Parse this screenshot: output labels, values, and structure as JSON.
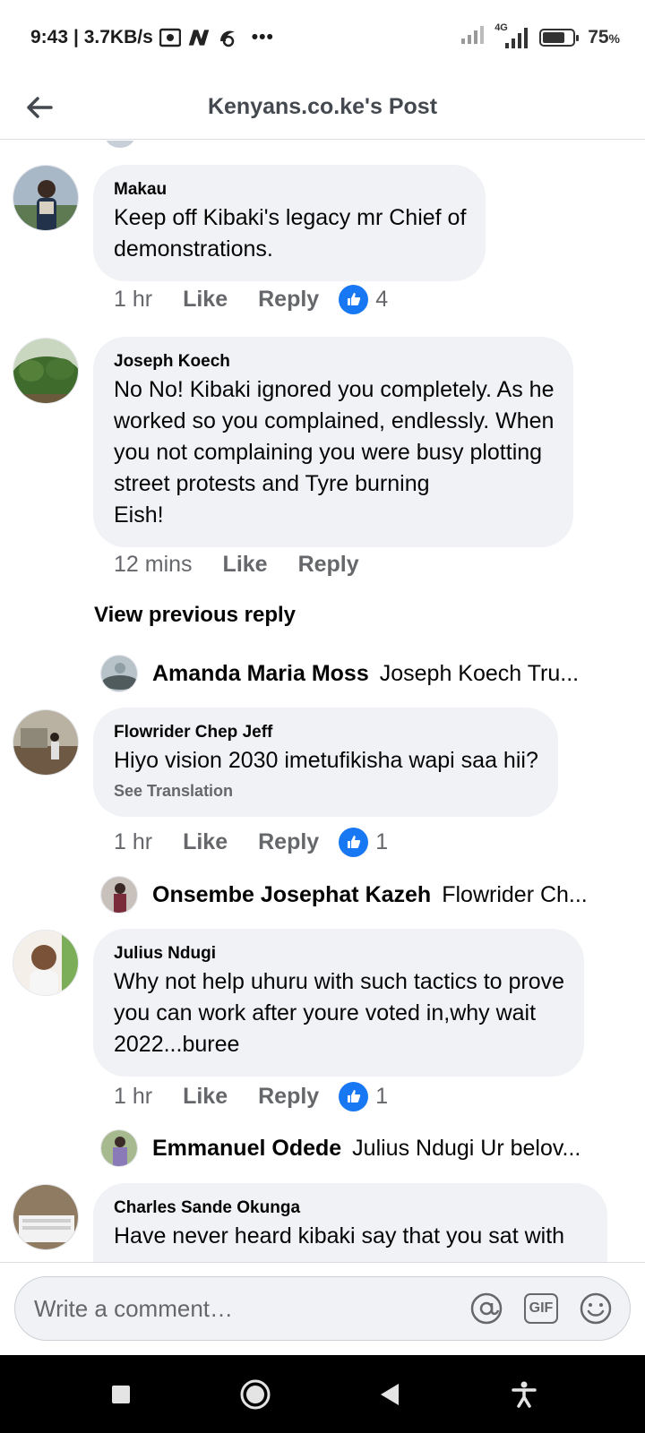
{
  "status_bar": {
    "time": "9:43",
    "net_speed": "| 3.7KB/s",
    "more": "•••",
    "network_type": "4G",
    "battery": "75",
    "battery_unit": "%",
    "battery_level": 0.75
  },
  "header": {
    "title": "Kenyans.co.ke's Post"
  },
  "comments": [
    {
      "author": "Makau",
      "text": "Keep off Kibaki's legacy mr Chief of\ndemonstrations.",
      "time": "1 hr",
      "like_label": "Like",
      "reply_label": "Reply",
      "reactions": "4",
      "avatar_color": "#4a6f8f"
    },
    {
      "author": "Joseph Koech",
      "text": "No No! Kibaki ignored you completely. As he\nworked so you complained, endlessly. When\nyou not complaining you were busy plotting\nstreet protests and Tyre burning\n Eish!",
      "time": "12 mins",
      "like_label": "Like",
      "reply_label": "Reply",
      "avatar_color": "#3e6b2f"
    },
    {
      "author": "Flowrider Chep Jeff",
      "text": "Hiyo vision 2030 imetufikisha wapi saa hii?",
      "translation": "See Translation",
      "time": "1 hr",
      "like_label": "Like",
      "reply_label": "Reply",
      "reactions": "1",
      "avatar_color": "#6b5a44"
    },
    {
      "author": "Julius Ndugi",
      "text": " Why not help uhuru with such tactics to prove\nyou can work after youre voted in,why wait\n2022...buree",
      "time": "1 hr",
      "like_label": "Like",
      "reply_label": "Reply",
      "reactions": "1",
      "avatar_color": "#d9c3a8"
    },
    {
      "author": "Charles Sande Okunga",
      "text": "Have never heard kibaki say that you sat with",
      "avatar_color": "#5b4632"
    }
  ],
  "view_previous_reply": "View previous reply",
  "replies": [
    {
      "name": "Amanda Maria Moss",
      "preview": "Joseph Koech Tru...",
      "avatar_color": "#7d8a8f"
    },
    {
      "name": "Onsembe Josephat Kazeh",
      "preview": "Flowrider Ch...",
      "avatar_color": "#5a3f3a"
    },
    {
      "name": "Emmanuel Odede",
      "preview": "Julius Ndugi Ur belov...",
      "avatar_color": "#7a6a9a"
    }
  ],
  "composer": {
    "placeholder": "Write a comment…",
    "mention_icon": "at-sign-icon",
    "gif_label": "GIF",
    "emoji_icon": "smiley-icon"
  },
  "colors": {
    "accent": "#1877f2",
    "bubble": "#f0f2f5",
    "secondary_text": "#65676b"
  }
}
